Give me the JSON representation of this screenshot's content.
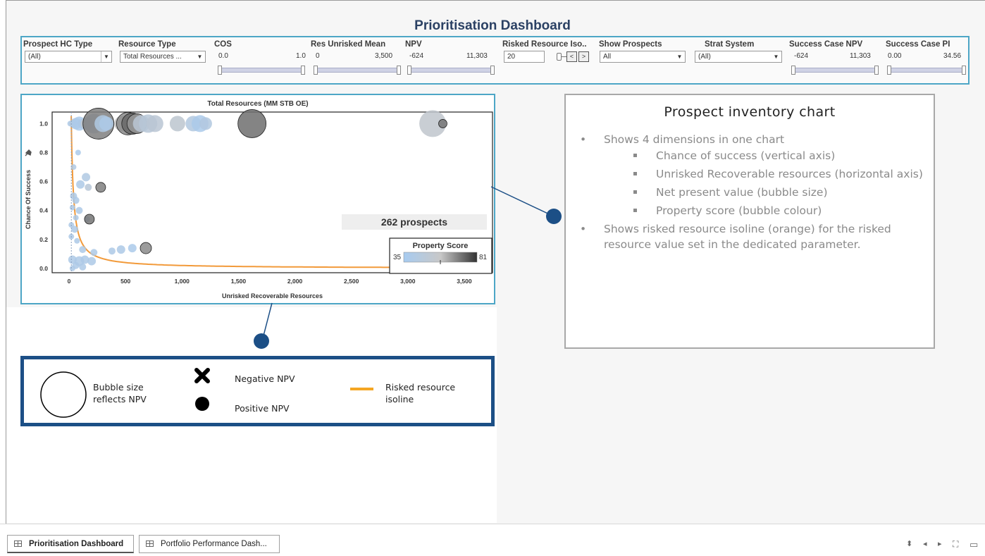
{
  "dashboard": {
    "title": "Prioritisation Dashboard"
  },
  "filters": {
    "prospect_hc_type": {
      "label": "Prospect HC Type",
      "value": "(All)"
    },
    "resource_type": {
      "label": "Resource Type",
      "value": "Total Resources ..."
    },
    "cos": {
      "label": "COS",
      "min": "0.0",
      "max": "1.0"
    },
    "res_unrisked_mean": {
      "label": "Res Unrisked Mean",
      "min": "0",
      "max": "3,500"
    },
    "npv": {
      "label": "NPV",
      "min": "-624",
      "max": "11,303"
    },
    "risked_resource_iso": {
      "label": "Risked Resource Iso..",
      "value": "20",
      "prev": "<",
      "next": ">"
    },
    "show_prospects": {
      "label": "Show Prospects",
      "value": "All"
    },
    "strat_system": {
      "label": "Strat System",
      "value": "(All)"
    },
    "success_case_npv": {
      "label": "Success Case NPV",
      "min": "-624",
      "max": "11,303"
    },
    "success_case_pi": {
      "label": "Success Case PI",
      "min": "0.00",
      "max": "34.56"
    }
  },
  "chart": {
    "count_label": "262 prospects",
    "color_legend": {
      "title": "Property Score",
      "min": "35",
      "max": "81"
    },
    "colors": {
      "low": "#a7cbf0",
      "mid": "#c4c4c4",
      "high": "#404040",
      "isoline": "#f29a3a",
      "frame": "#4da6c6"
    }
  },
  "chart_data": {
    "type": "scatter",
    "title": "Total Resources (MM STB OE)",
    "xlabel": "Unrisked Recoverable Resources",
    "ylabel": "Chance Of Success",
    "xlim": [
      -150,
      3750
    ],
    "ylim": [
      -0.03,
      1.08
    ],
    "xticks": [
      0,
      500,
      1000,
      1500,
      2000,
      2500,
      3000,
      3500
    ],
    "xtick_labels": [
      "0",
      "500",
      "1,000",
      "1,500",
      "2,000",
      "2,500",
      "3,000",
      "3,500"
    ],
    "yticks": [
      0,
      0.2,
      0.4,
      0.6,
      0.8,
      1.0
    ],
    "ytick_labels": [
      "0.0",
      "0.2",
      "0.4",
      "0.6",
      "0.8",
      "1.0"
    ],
    "size_encodes": "NPV",
    "color_encodes": "Property Score",
    "isoline_risked_resource": 20,
    "points": [
      {
        "x": 10,
        "y": 1.0,
        "s": 4,
        "score": 40
      },
      {
        "x": 40,
        "y": 1.0,
        "s": 6,
        "score": 48
      },
      {
        "x": 60,
        "y": 1.0,
        "s": 8,
        "score": 42
      },
      {
        "x": 90,
        "y": 1.0,
        "s": 10,
        "score": 38
      },
      {
        "x": 120,
        "y": 1.0,
        "s": 7,
        "score": 40
      },
      {
        "x": 160,
        "y": 1.0,
        "s": 9,
        "score": 55
      },
      {
        "x": 220,
        "y": 1.0,
        "s": 14,
        "score": 46
      },
      {
        "x": 260,
        "y": 1.0,
        "s": 22,
        "score": 70
      },
      {
        "x": 300,
        "y": 1.0,
        "s": 12,
        "score": 42
      },
      {
        "x": 330,
        "y": 1.0,
        "s": 10,
        "score": 40
      },
      {
        "x": 470,
        "y": 1.0,
        "s": 11,
        "score": 60
      },
      {
        "x": 520,
        "y": 1.0,
        "s": 16,
        "score": 68
      },
      {
        "x": 560,
        "y": 1.0,
        "s": 15,
        "score": 74
      },
      {
        "x": 600,
        "y": 1.0,
        "s": 14,
        "score": 66
      },
      {
        "x": 640,
        "y": 1.0,
        "s": 12,
        "score": 50
      },
      {
        "x": 700,
        "y": 1.0,
        "s": 13,
        "score": 48
      },
      {
        "x": 760,
        "y": 1.0,
        "s": 12,
        "score": 50
      },
      {
        "x": 960,
        "y": 1.0,
        "s": 11,
        "score": 52
      },
      {
        "x": 1100,
        "y": 1.0,
        "s": 11,
        "score": 44
      },
      {
        "x": 1160,
        "y": 1.0,
        "s": 12,
        "score": 38
      },
      {
        "x": 1210,
        "y": 1.0,
        "s": 9,
        "score": 44
      },
      {
        "x": 1620,
        "y": 1.0,
        "s": 20,
        "score": 73
      },
      {
        "x": 3220,
        "y": 1.0,
        "s": 19,
        "score": 54
      },
      {
        "x": 3310,
        "y": 1.0,
        "s": 6,
        "score": 72
      },
      {
        "x": 80,
        "y": 0.8,
        "s": 4,
        "score": 38
      },
      {
        "x": 40,
        "y": 0.7,
        "s": 4,
        "score": 42
      },
      {
        "x": 150,
        "y": 0.63,
        "s": 6,
        "score": 42
      },
      {
        "x": 100,
        "y": 0.58,
        "s": 6,
        "score": 40
      },
      {
        "x": 170,
        "y": 0.56,
        "s": 5,
        "score": 48
      },
      {
        "x": 280,
        "y": 0.56,
        "s": 7,
        "score": 70
      },
      {
        "x": 40,
        "y": 0.5,
        "s": 5,
        "score": 40
      },
      {
        "x": 60,
        "y": 0.47,
        "s": 5,
        "score": 40
      },
      {
        "x": 30,
        "y": 0.42,
        "s": 4,
        "score": 40
      },
      {
        "x": 90,
        "y": 0.4,
        "s": 5,
        "score": 40
      },
      {
        "x": 60,
        "y": 0.35,
        "s": 4,
        "score": 40
      },
      {
        "x": 160,
        "y": 0.34,
        "s": 4,
        "score": 40
      },
      {
        "x": 180,
        "y": 0.34,
        "s": 7,
        "score": 72
      },
      {
        "x": 20,
        "y": 0.3,
        "s": 4,
        "score": 40
      },
      {
        "x": 50,
        "y": 0.27,
        "s": 5,
        "score": 40
      },
      {
        "x": 20,
        "y": 0.22,
        "s": 4,
        "score": 40
      },
      {
        "x": 70,
        "y": 0.19,
        "s": 4,
        "score": 40
      },
      {
        "x": 120,
        "y": 0.13,
        "s": 5,
        "score": 40
      },
      {
        "x": 220,
        "y": 0.11,
        "s": 5,
        "score": 40
      },
      {
        "x": 380,
        "y": 0.12,
        "s": 5,
        "score": 40
      },
      {
        "x": 460,
        "y": 0.13,
        "s": 6,
        "score": 40
      },
      {
        "x": 560,
        "y": 0.14,
        "s": 6,
        "score": 38
      },
      {
        "x": 680,
        "y": 0.14,
        "s": 8,
        "score": 68
      },
      {
        "x": 30,
        "y": 0.06,
        "s": 6,
        "score": 40
      },
      {
        "x": 90,
        "y": 0.05,
        "s": 7,
        "score": 40
      },
      {
        "x": 140,
        "y": 0.06,
        "s": 6,
        "score": 40
      },
      {
        "x": 200,
        "y": 0.05,
        "s": 6,
        "score": 40
      },
      {
        "x": 60,
        "y": 0.02,
        "s": 5,
        "score": 40
      },
      {
        "x": 120,
        "y": 0.01,
        "s": 5,
        "score": 40
      },
      {
        "x": 30,
        "y": 0.0,
        "s": 4,
        "score": 40
      }
    ]
  },
  "annotation": {
    "title": "Prospect inventory chart",
    "bullets": [
      {
        "text": "Shows 4 dimensions in one chart",
        "sub": [
          "Chance of success (vertical axis)",
          "Unrisked Recoverable resources (horizontal axis)",
          "Net present value (bubble size)",
          "Property score (bubble colour)"
        ]
      },
      {
        "text": "Shows risked resource isoline (orange) for the risked resource value set in the dedicated parameter.",
        "sub": []
      }
    ]
  },
  "legend": {
    "bubble": "Bubble size reflects NPV",
    "negative": "Negative NPV",
    "positive": "Positive NPV",
    "isoline": "Risked resource isoline",
    "colors": {
      "border": "#1c4f86",
      "isoline": "#f5a623"
    }
  },
  "tabs": [
    {
      "label": "Prioritisation Dashboard",
      "active": true
    },
    {
      "label": "Portfolio Performance Dash...",
      "active": false
    }
  ]
}
